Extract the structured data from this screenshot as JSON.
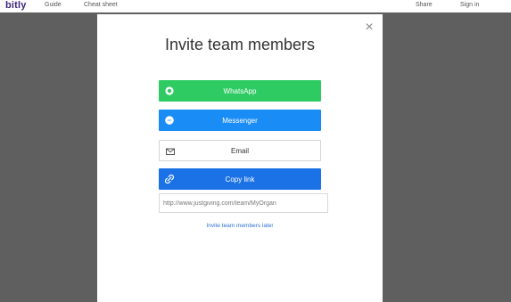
{
  "header": {
    "brand": "bitly",
    "nav_left": [
      "Guide",
      "Cheat sheet"
    ],
    "nav_right": [
      "Share",
      "Sign in"
    ]
  },
  "modal": {
    "title": "Invite team members",
    "close_icon": "close-icon",
    "buttons": {
      "whatsapp": {
        "label": "WhatsApp",
        "icon": "whatsapp-icon",
        "color": "#2ecb63"
      },
      "messenger": {
        "label": "Messenger",
        "icon": "messenger-icon",
        "color": "#1a8cf5"
      },
      "email": {
        "label": "Email",
        "icon": "email-icon",
        "color": "#ffffff"
      },
      "copy_link": {
        "label": "Copy link",
        "icon": "link-icon",
        "color": "#1b72e6"
      }
    },
    "invite_link_value": "http://www.justgiving.com/team/MyOrgan",
    "later_link": "Invite team members later"
  }
}
